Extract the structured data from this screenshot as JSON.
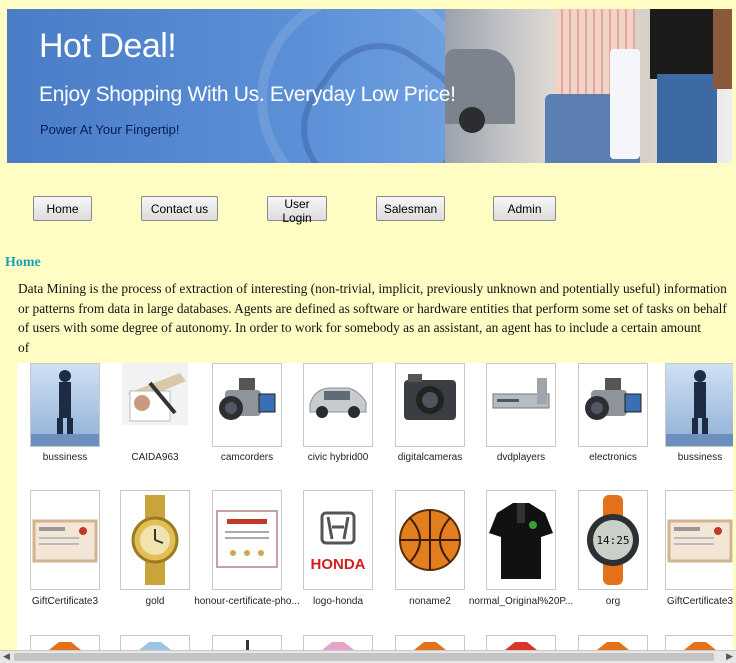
{
  "banner": {
    "title": "Hot Deal!",
    "tagline": "Enjoy Shopping With Us. Everyday Low Price!",
    "subtitle": "Power At Your Fingertip!"
  },
  "nav": {
    "home": "Home",
    "contact": "Contact us",
    "login": "User Login",
    "salesman": "Salesman",
    "admin": "Admin"
  },
  "content": {
    "heading": "Home",
    "description": "Data Mining is the process of extraction of interesting (non-trivial, implicit, previously unknown and potentially useful) information or patterns from data in large databases. Agents are defined as software or hardware entities that perform some set of tasks on behalf of users with some degree of autonomy. In order to work for somebody as an assistant, an agent has to include a certain amount",
    "description_tail": "of"
  },
  "gallery": {
    "row1": [
      {
        "label": "bussiness",
        "icon": "business-man-icon"
      },
      {
        "label": "CAIDA963",
        "icon": "pen-writing-icon"
      },
      {
        "label": "camcorders",
        "icon": "camcorder-icon"
      },
      {
        "label": "civic hybrid00",
        "icon": "car-icon"
      },
      {
        "label": "digitalcameras",
        "icon": "camera-icon"
      },
      {
        "label": "dvdplayers",
        "icon": "dvd-player-icon"
      },
      {
        "label": "electronics",
        "icon": "camcorder-icon"
      },
      {
        "label": "bussiness",
        "icon": "business-man-icon"
      }
    ],
    "row2": [
      {
        "label": "GiftCertificate3",
        "icon": "gift-certificate-icon"
      },
      {
        "label": "gold",
        "icon": "gold-watch-icon"
      },
      {
        "label": "honour-certificate-pho...",
        "icon": "certificate-icon"
      },
      {
        "label": "logo-honda",
        "icon": "honda-logo-icon",
        "logo_text": "HONDA"
      },
      {
        "label": "noname2",
        "icon": "basketball-icon"
      },
      {
        "label": "normal_Original%20P...",
        "icon": "polo-shirt-icon"
      },
      {
        "label": "org",
        "icon": "digital-watch-icon",
        "screen_text": "14:25"
      },
      {
        "label": "GiftCertificate3",
        "icon": "gift-certificate-icon"
      }
    ]
  }
}
